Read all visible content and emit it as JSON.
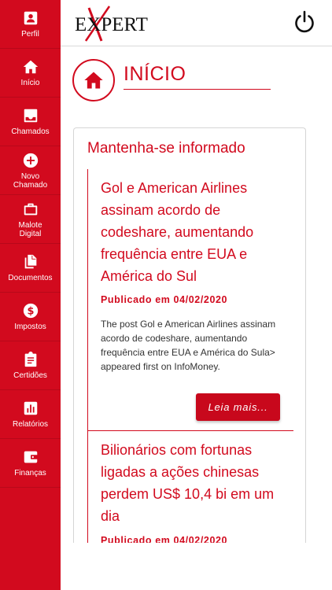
{
  "colors": {
    "brand_red": "#d20a1e",
    "text_dark": "#333333"
  },
  "header": {
    "logo_text": "EXPERT",
    "power_icon": "power-icon"
  },
  "sidebar": {
    "items": [
      {
        "label": "Perfil",
        "icon": "person-icon"
      },
      {
        "label": "Início",
        "icon": "home-icon"
      },
      {
        "label": "Chamados",
        "icon": "inbox-icon"
      },
      {
        "label": "Novo Chamado",
        "icon": "plus-circle-icon"
      },
      {
        "label": "Malote Digital",
        "icon": "briefcase-icon"
      },
      {
        "label": "Documentos",
        "icon": "documents-icon"
      },
      {
        "label": "Impostos",
        "icon": "dollar-circle-icon"
      },
      {
        "label": "Certidões",
        "icon": "clipboard-icon"
      },
      {
        "label": "Relatórios",
        "icon": "bar-chart-icon"
      },
      {
        "label": "Finanças",
        "icon": "wallet-icon"
      }
    ]
  },
  "page": {
    "title": "INÍCIO"
  },
  "news": {
    "section_title": "Mantenha-se informado",
    "articles": [
      {
        "title": "Gol e American Airlines assinam acordo de codeshare, aumentando frequência entre EUA e América do Sul",
        "date": "Publicado em 04/02/2020",
        "excerpt": "The post Gol e American Airlines assinam acordo de codeshare, aumentando frequência entre EUA e América do Sula> appeared first on InfoMoney.",
        "button": "Leia mais..."
      },
      {
        "title": "Bilionários com fortunas ligadas a ações chinesas perdem US$ 10,4 bi em um dia",
        "date": "Publicado em 04/02/2020"
      }
    ]
  }
}
